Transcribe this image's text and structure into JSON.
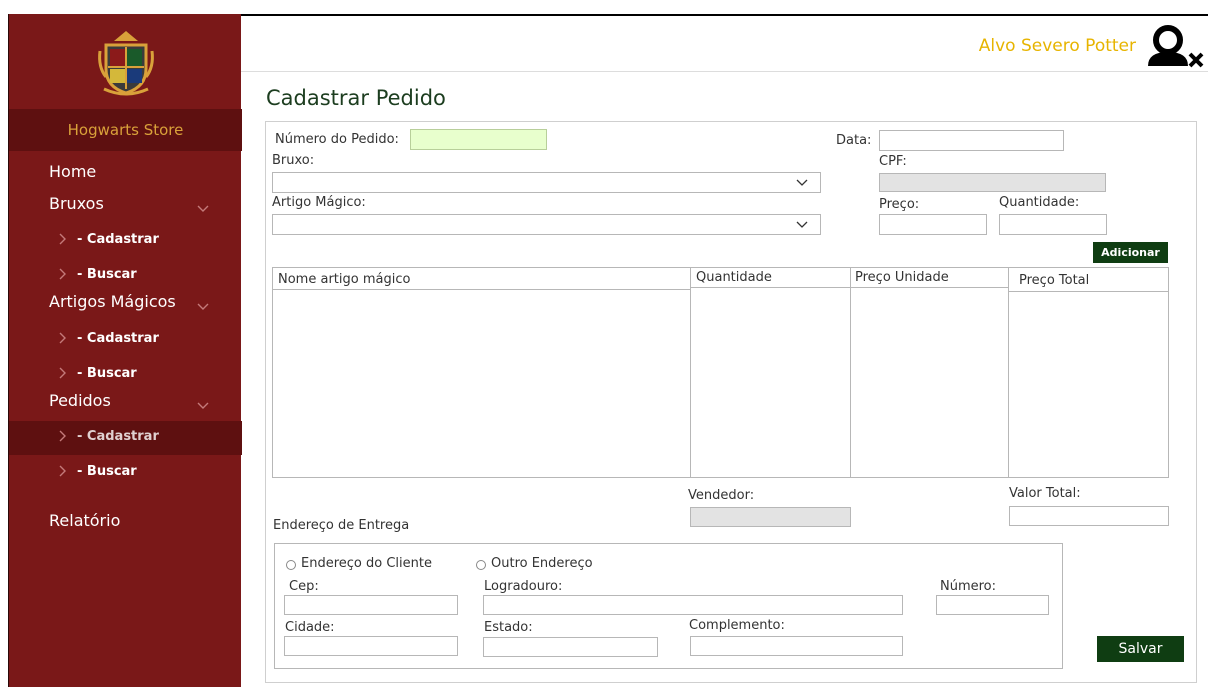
{
  "sidebar": {
    "store_name": "Hogwarts Store",
    "menu": {
      "home": "Home",
      "bruxos": "Bruxos",
      "bruxos_cadastrar": "- Cadastrar",
      "bruxos_buscar": "- Buscar",
      "artigos": "Artigos Mágicos",
      "artigos_cadastrar": "- Cadastrar",
      "artigos_buscar": "- Buscar",
      "pedidos": "Pedidos",
      "pedidos_cadastrar": "- Cadastrar",
      "pedidos_buscar": "- Buscar",
      "relatorio": "Relatório"
    },
    "active_item": "pedidos_cadastrar"
  },
  "header": {
    "username": "Alvo Severo Potter",
    "logout_icon": "user-remove-icon"
  },
  "page": {
    "title": "Cadastrar Pedido"
  },
  "form": {
    "numero_label": "Número do Pedido:",
    "numero_value": "",
    "data_label": "Data:",
    "data_value": "",
    "bruxo_label": "Bruxo:",
    "bruxo_value": "",
    "cpf_label": "CPF:",
    "cpf_value": "",
    "artigo_label": "Artigo Mágico:",
    "artigo_value": "",
    "preco_label": "Preço:",
    "preco_value": "",
    "quantidade_label": "Quantidade:",
    "quantidade_value": "",
    "add_button": "Adicionar"
  },
  "table": {
    "headers": [
      "Nome artigo mágico",
      "Quantidade",
      "Preço Unidade",
      "Preço Total"
    ],
    "rows": []
  },
  "summary": {
    "vendedor_label": "Vendedor:",
    "vendedor_value": "",
    "valor_total_label": "Valor Total:",
    "valor_total_value": ""
  },
  "address": {
    "section_label": "Endereço de Entrega",
    "option_cliente": "Endereço do Cliente",
    "option_outro": "Outro Endereço",
    "cep_label": "Cep:",
    "logradouro_label": "Logradouro:",
    "numero_label": "Número:",
    "cidade_label": "Cidade:",
    "estado_label": "Estado:",
    "complemento_label": "Complemento:"
  },
  "actions": {
    "save_button": "Salvar"
  },
  "colors": {
    "sidebar_bg": "#7a1818",
    "sidebar_active": "#5e1010",
    "store_title": "#d9a13a",
    "username": "#e7b400",
    "button_bg": "#0f3d12",
    "numero_field_bg": "#e8ffcd"
  }
}
